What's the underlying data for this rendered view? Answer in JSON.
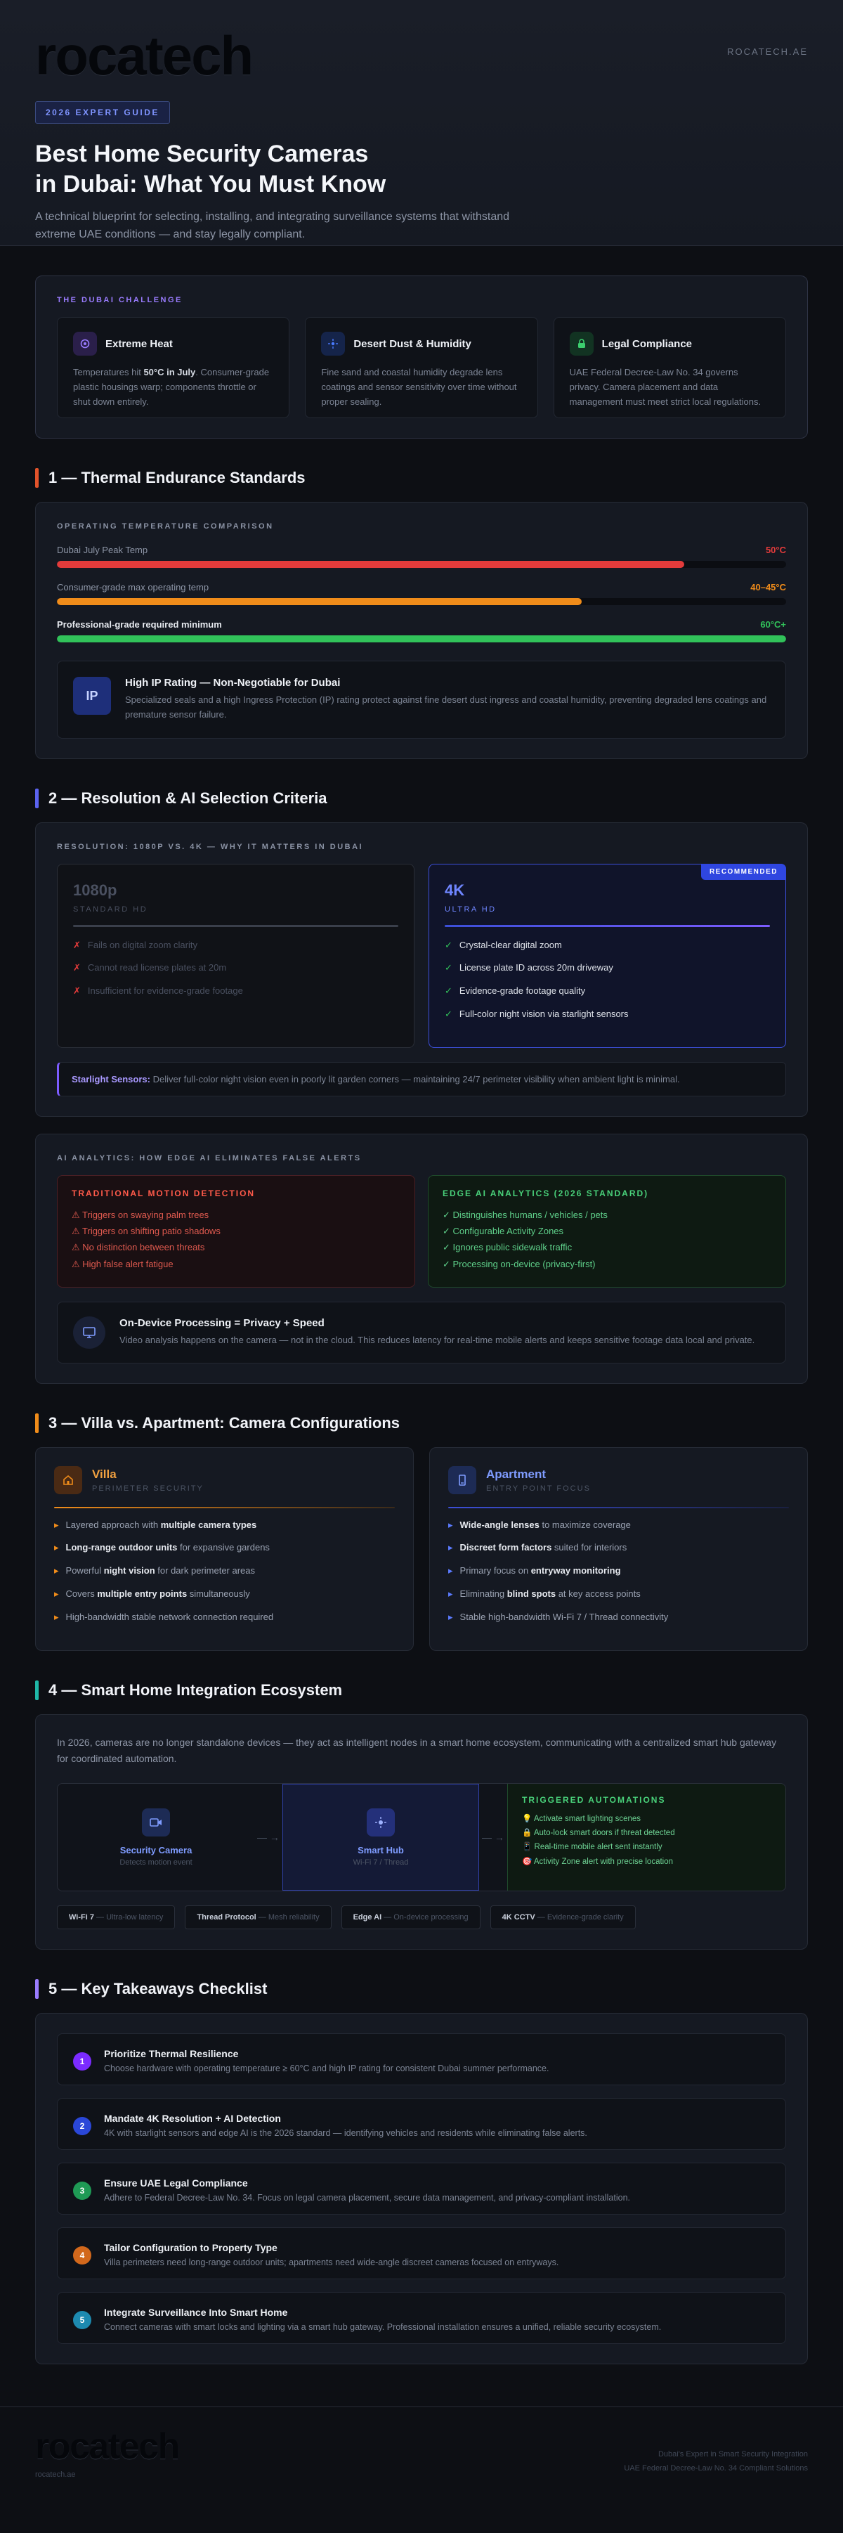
{
  "header": {
    "logo": "rocatech",
    "domain": "ROCATECH.AE",
    "badge": "2026 EXPERT GUIDE",
    "title_line1": "Best Home Security Cameras",
    "title_line2": "in Dubai: What You Must Know",
    "subtitle": "A technical blueprint for selecting, installing, and integrating surveillance systems that withstand extreme UAE conditions — and stay legally compliant."
  },
  "challenge": {
    "kicker": "THE DUBAI CHALLENGE",
    "items": [
      {
        "title": "Extreme Heat",
        "text_pre": "Temperatures hit ",
        "text_bold": "50°C in July",
        "text_post": ". Consumer-grade plastic housings warp; components throttle or shut down entirely.",
        "icon": "thermometer-icon",
        "color": "#9a7cff"
      },
      {
        "title": "Desert Dust & Humidity",
        "text": "Fine sand and coastal humidity degrade lens coatings and sensor sensitivity over time without proper sealing.",
        "icon": "dust-icon",
        "color": "#4a7bff"
      },
      {
        "title": "Legal Compliance",
        "text": "UAE Federal Decree-Law No. 34 governs privacy. Camera placement and data management must meet strict local regulations.",
        "icon": "lock-icon",
        "color": "#3ccf6e"
      }
    ]
  },
  "sec1": {
    "title": "1 — Thermal Endurance Standards",
    "kicker": "OPERATING TEMPERATURE COMPARISON",
    "rows": [
      {
        "label": "Dubai July Peak Temp",
        "value": "50°C",
        "fraction": 0.86,
        "color": "#e23b3b"
      },
      {
        "label": "Consumer-grade max operating temp",
        "value": "40–45°C",
        "fraction": 0.72,
        "color": "#f08c1a"
      },
      {
        "label": "Professional-grade required minimum",
        "value": "60°C+",
        "fraction": 1.0,
        "color": "#31c25a"
      }
    ],
    "ip_badge": "IP",
    "ip_title": "High IP Rating — Non-Negotiable for Dubai",
    "ip_text": "Specialized seals and a high Ingress Protection (IP) rating protect against fine desert dust ingress and coastal humidity, preventing degraded lens coatings and premature sensor failure."
  },
  "sec2": {
    "title": "2 — Resolution & AI Selection Criteria",
    "kicker": "RESOLUTION: 1080P VS. 4K — WHY IT MATTERS IN DUBAI",
    "hd": {
      "title": "1080p",
      "sub": "STANDARD HD",
      "items": [
        "Fails on digital zoom clarity",
        "Cannot read license plates at 20m",
        "Insufficient for evidence-grade footage"
      ]
    },
    "uhd": {
      "title": "4K",
      "sub": "ULTRA HD",
      "badge": "RECOMMENDED",
      "items": [
        "Crystal-clear digital zoom",
        "License plate ID across 20m driveway",
        "Evidence-grade footage quality",
        "Full-color night vision via starlight sensors"
      ]
    },
    "starlight_bold": "Starlight Sensors:",
    "starlight_text": " Deliver full-color night vision even in poorly lit garden corners — maintaining 24/7 perimeter visibility when ambient light is minimal.",
    "ai_kicker": "AI ANALYTICS: HOW EDGE AI ELIMINATES FALSE ALERTS",
    "trad": {
      "title": "TRADITIONAL MOTION DETECTION",
      "items": [
        "⚠ Triggers on swaying palm trees",
        "⚠ Triggers on shifting patio shadows",
        "⚠ No distinction between threats",
        "⚠ High false alert fatigue"
      ]
    },
    "edge": {
      "title": "EDGE AI ANALYTICS (2026 STANDARD)",
      "items": [
        "✓ Distinguishes humans / vehicles / pets",
        "✓ Configurable Activity Zones",
        "✓ Ignores public sidewalk traffic",
        "✓ Processing on-device (privacy-first)"
      ]
    },
    "device_title": "On-Device Processing = Privacy + Speed",
    "device_text": "Video analysis happens on the camera — not in the cloud. This reduces latency for real-time mobile alerts and keeps sensitive footage data local and private."
  },
  "sec3": {
    "title": "3 — Villa vs. Apartment: Camera Configurations",
    "villa": {
      "name": "Villa",
      "sub": "PERIMETER SECURITY",
      "items": [
        {
          "pre": "Layered approach with ",
          "bold": "multiple camera types",
          "post": ""
        },
        {
          "pre": "",
          "bold": "Long-range outdoor units",
          "post": " for expansive gardens"
        },
        {
          "pre": "Powerful ",
          "bold": "night vision",
          "post": " for dark perimeter areas"
        },
        {
          "pre": "Covers ",
          "bold": "multiple entry points",
          "post": " simultaneously"
        },
        {
          "pre": "High-bandwidth stable network connection required",
          "bold": "",
          "post": ""
        }
      ]
    },
    "apartment": {
      "name": "Apartment",
      "sub": "ENTRY POINT FOCUS",
      "items": [
        {
          "pre": "",
          "bold": "Wide-angle lenses",
          "post": " to maximize coverage"
        },
        {
          "pre": "",
          "bold": "Discreet form factors",
          "post": " suited for interiors"
        },
        {
          "pre": "Primary focus on ",
          "bold": "entryway monitoring",
          "post": ""
        },
        {
          "pre": "Eliminating ",
          "bold": "blind spots",
          "post": " at key access points"
        },
        {
          "pre": "Stable high-bandwidth Wi-Fi 7 / Thread connectivity",
          "bold": "",
          "post": ""
        }
      ]
    }
  },
  "sec4": {
    "title": "4 — Smart Home Integration Ecosystem",
    "intro": "In 2026, cameras are no longer standalone devices — they act as intelligent nodes in a smart home ecosystem, communicating with a centralized smart hub gateway for coordinated automation.",
    "camera": {
      "name": "Security Camera",
      "sub": "Detects motion event"
    },
    "hub": {
      "name": "Smart Hub",
      "sub": "Wi-Fi 7 / Thread"
    },
    "trig_title": "TRIGGERED AUTOMATIONS",
    "triggers": [
      "💡 Activate smart lighting scenes",
      "🔒 Auto-lock smart doors if threat detected",
      "📱 Real-time mobile alert sent instantly",
      "🎯 Activity Zone alert with precise location"
    ],
    "tags": [
      {
        "bold": "Wi-Fi 7",
        "text": " — Ultra-low latency"
      },
      {
        "bold": "Thread Protocol",
        "text": " — Mesh reliability"
      },
      {
        "bold": "Edge AI",
        "text": " — On-device processing"
      },
      {
        "bold": "4K CCTV",
        "text": " — Evidence-grade clarity"
      }
    ]
  },
  "sec5": {
    "title": "5 — Key Takeaways Checklist",
    "items": [
      {
        "n": "1",
        "color": "#7b2bff",
        "title": "Prioritize Thermal Resilience",
        "text": "Choose hardware with operating temperature ≥ 60°C and high IP rating for consistent Dubai summer performance."
      },
      {
        "n": "2",
        "color": "#2a47d8",
        "title": "Mandate 4K Resolution + AI Detection",
        "text": "4K with starlight sensors and edge AI is the 2026 standard — identifying vehicles and residents while eliminating false alerts."
      },
      {
        "n": "3",
        "color": "#1f9a55",
        "title": "Ensure UAE Legal Compliance",
        "text": "Adhere to Federal Decree-Law No. 34. Focus on legal camera placement, secure data management, and privacy-compliant installation."
      },
      {
        "n": "4",
        "color": "#d2681c",
        "title": "Tailor Configuration to Property Type",
        "text": "Villa perimeters need long-range outdoor units; apartments need wide-angle discreet cameras focused on entryways."
      },
      {
        "n": "5",
        "color": "#1d8ab0",
        "title": "Integrate Surveillance Into Smart Home",
        "text": "Connect cameras with smart locks and lighting via a smart hub gateway. Professional installation ensures a unified, reliable security ecosystem."
      }
    ]
  },
  "footer": {
    "logo": "rocatech",
    "domain": "rocatech.ae",
    "line1": "Dubai's Expert in Smart Security Integration",
    "line2": "UAE Federal Decree-Law No. 34 Compliant Solutions"
  }
}
